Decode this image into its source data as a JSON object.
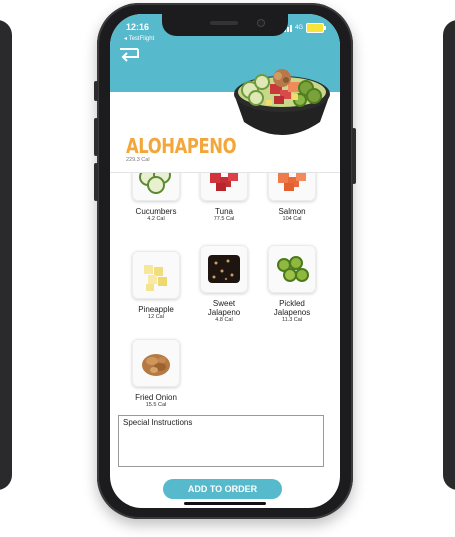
{
  "status_bar": {
    "time": "12:16",
    "back_app": "◂ TestFlight",
    "network": "4G"
  },
  "product": {
    "title": "ALOHAPENO",
    "calories": "229.3 Cal"
  },
  "items": [
    {
      "name": "Cucumbers",
      "cal": "4.2 Cal",
      "icon": "cucumber-icon"
    },
    {
      "name": "Tuna",
      "cal": "77.5 Cal",
      "icon": "tuna-icon"
    },
    {
      "name": "Salmon",
      "cal": "104 Cal",
      "icon": "salmon-icon"
    },
    {
      "name": "Pineapple",
      "cal": "12 Cal",
      "icon": "pineapple-icon"
    },
    {
      "name": "Sweet Jalapeno",
      "cal": "4.8 Cal",
      "icon": "sweet-jalapeno-icon"
    },
    {
      "name": "Pickled Jalapenos",
      "cal": "11.3 Cal",
      "icon": "pickled-jalapeno-icon"
    },
    {
      "name": "Fried Onion",
      "cal": "15.5 Cal",
      "icon": "fried-onion-icon"
    }
  ],
  "instructions": {
    "label": "Special Instructions",
    "value": ""
  },
  "add_button": "ADD TO ORDER",
  "colors": {
    "header": "#57b9cc",
    "title": "#f3a73b",
    "button": "#57b9cc"
  }
}
